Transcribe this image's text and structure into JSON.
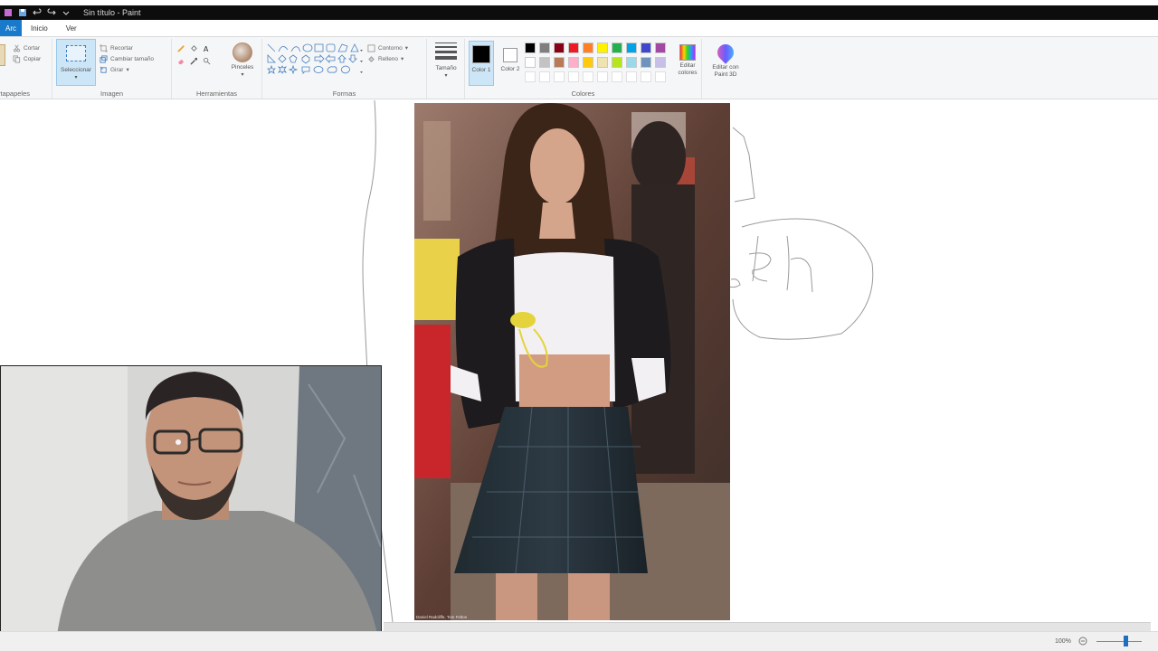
{
  "window": {
    "title": "Sin título - Paint"
  },
  "tabs": [
    {
      "label": "Arc"
    },
    {
      "label": "Inicio"
    },
    {
      "label": "Ver"
    }
  ],
  "ribbon": {
    "clipboard": {
      "cut_label": "Cortar",
      "copy_label": "Copiar",
      "group_label": "rtapapeles"
    },
    "image": {
      "select_label": "Seleccionar",
      "crop_label": "Recortar",
      "resize_label": "Cambiar tamaño",
      "rotate_label": "Girar",
      "group_label": "Imagen"
    },
    "tools": {
      "group_label": "Herramientas",
      "brushes_label": "Pinceles"
    },
    "shapes": {
      "outline_label": "Contorno",
      "fill_label": "Relleno",
      "group_label": "Formas"
    },
    "size": {
      "label": "Tamaño"
    },
    "colors": {
      "color1_label": "Color 1",
      "color2_label": "Color 2",
      "edit_colors_label": "Editar colores",
      "paint3d_label": "Editar con Paint 3D",
      "group_label": "Colores",
      "color1": "#000000",
      "color2": "#ffffff",
      "palette_row1": [
        "#000000",
        "#7f7f7f",
        "#880015",
        "#ed1c24",
        "#ff7f27",
        "#fff200",
        "#22b14c",
        "#00a2e8",
        "#3f48cc",
        "#a349a4"
      ],
      "palette_row2": [
        "#ffffff",
        "#c3c3c3",
        "#b97a57",
        "#ffaec9",
        "#ffc90e",
        "#efe4b0",
        "#b5e61d",
        "#99d9ea",
        "#7092be",
        "#c8bfe7"
      ]
    }
  },
  "canvas": {
    "photo_caption": "Daniel Radcliffe, Tom Felton"
  },
  "status": {
    "zoom": "100%"
  }
}
